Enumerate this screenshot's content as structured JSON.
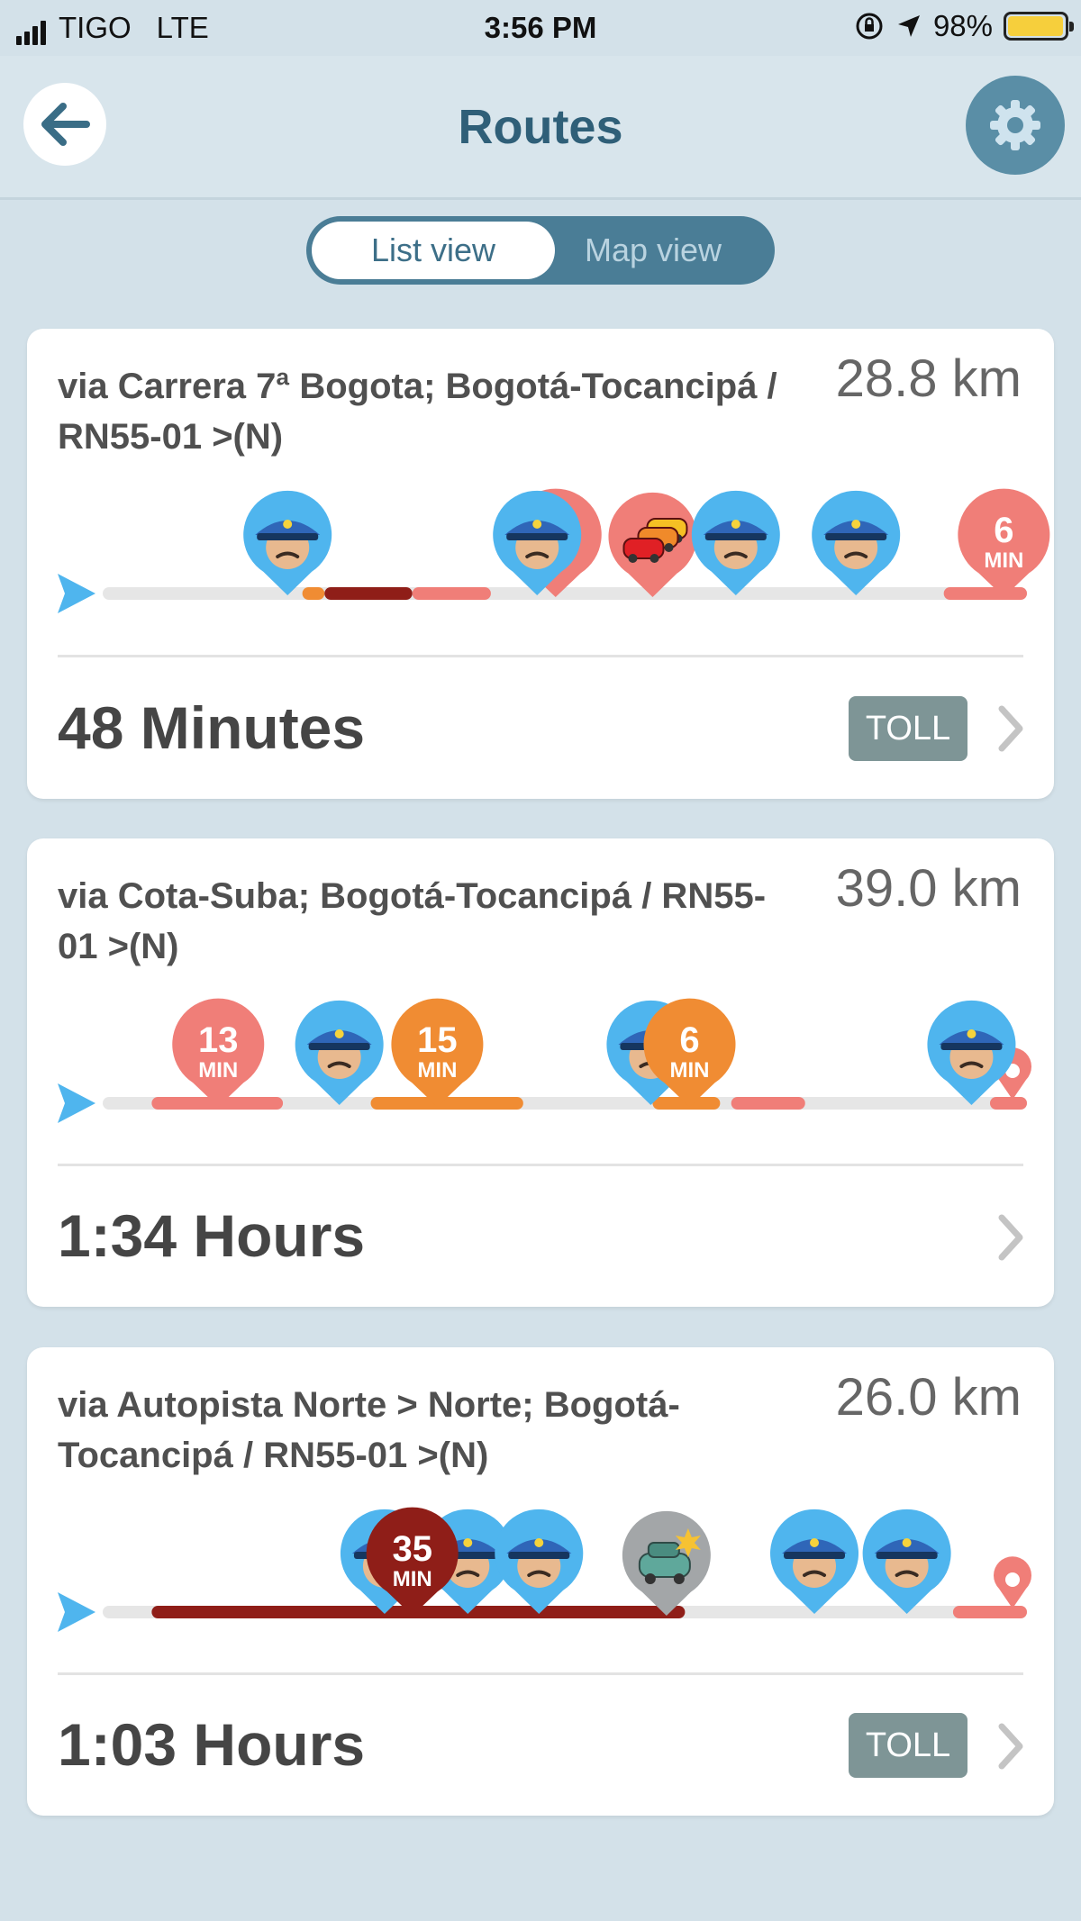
{
  "status_bar": {
    "carrier": "TIGO",
    "network": "LTE",
    "time": "3:56 PM",
    "battery": "98%",
    "battery_level": 0.98
  },
  "header": {
    "title": "Routes",
    "back_icon": "back-arrow-icon",
    "settings_icon": "gear-icon"
  },
  "view_toggle": {
    "list_label": "List view",
    "map_label": "Map view",
    "selected": "List view"
  },
  "colors": {
    "accent": "#2f5f78",
    "toggle_bg": "#4a7d96",
    "police_pin": "#4fb5ee",
    "traffic_light": "#f07e78",
    "traffic_medium": "#f08c33",
    "traffic_heavy": "#8f1e18",
    "toll_badge": "#7e9596"
  },
  "routes": [
    {
      "name": "via Carrera 7ª Bogota; Bogotá-Tocancipá / RN55-01 >(N)",
      "distance": "28.8 km",
      "duration": "48 Minutes",
      "toll": "TOLL",
      "segments": [
        {
          "from": 0.216,
          "to": 0.24,
          "level": "medium"
        },
        {
          "from": 0.24,
          "to": 0.335,
          "level": "heavy"
        },
        {
          "from": 0.335,
          "to": 0.42,
          "level": "light"
        },
        {
          "from": 0.91,
          "to": 1.0,
          "level": "light"
        }
      ],
      "pins": [
        {
          "kind": "police",
          "at": 0.2
        },
        {
          "kind": "traffic",
          "at": 0.49,
          "value": "",
          "level": "light"
        },
        {
          "kind": "police",
          "at": 0.47
        },
        {
          "kind": "jam",
          "at": 0.595
        },
        {
          "kind": "police",
          "at": 0.685
        },
        {
          "kind": "police",
          "at": 0.815
        },
        {
          "kind": "traffic",
          "at": 0.975,
          "value": "6",
          "unit": "MIN",
          "level": "light"
        }
      ],
      "destination_color": "light"
    },
    {
      "name": "via Cota-Suba; Bogotá-Tocancipá / RN55-01 >(N)",
      "distance": "39.0 km",
      "duration": "1:34 Hours",
      "toll": "",
      "segments": [
        {
          "from": 0.053,
          "to": 0.195,
          "level": "light"
        },
        {
          "from": 0.29,
          "to": 0.455,
          "level": "medium"
        },
        {
          "from": 0.595,
          "to": 0.668,
          "level": "medium"
        },
        {
          "from": 0.68,
          "to": 0.76,
          "level": "light"
        },
        {
          "from": 0.96,
          "to": 1.0,
          "level": "light"
        }
      ],
      "pins": [
        {
          "kind": "traffic",
          "at": 0.125,
          "value": "13",
          "unit": "MIN",
          "level": "light"
        },
        {
          "kind": "police",
          "at": 0.256
        },
        {
          "kind": "traffic",
          "at": 0.362,
          "value": "15",
          "unit": "MIN",
          "level": "medium"
        },
        {
          "kind": "police",
          "at": 0.593
        },
        {
          "kind": "traffic",
          "at": 0.635,
          "value": "6",
          "unit": "MIN",
          "level": "medium"
        },
        {
          "kind": "police",
          "at": 0.94
        }
      ],
      "destination_color": "light"
    },
    {
      "name": "via Autopista Norte > Norte; Bogotá-Tocancipá / RN55-01 >(N)",
      "distance": "26.0 km",
      "duration": "1:03 Hours",
      "toll": "TOLL",
      "segments": [
        {
          "from": 0.053,
          "to": 0.63,
          "level": "heavy"
        },
        {
          "from": 0.92,
          "to": 1.0,
          "level": "light"
        }
      ],
      "pins": [
        {
          "kind": "police",
          "at": 0.305
        },
        {
          "kind": "police",
          "at": 0.395
        },
        {
          "kind": "police",
          "at": 0.472
        },
        {
          "kind": "traffic",
          "at": 0.335,
          "value": "35",
          "unit": "MIN",
          "level": "heavy"
        },
        {
          "kind": "accident",
          "at": 0.61
        },
        {
          "kind": "police",
          "at": 0.77
        },
        {
          "kind": "police",
          "at": 0.87
        }
      ],
      "destination_color": "light"
    }
  ]
}
